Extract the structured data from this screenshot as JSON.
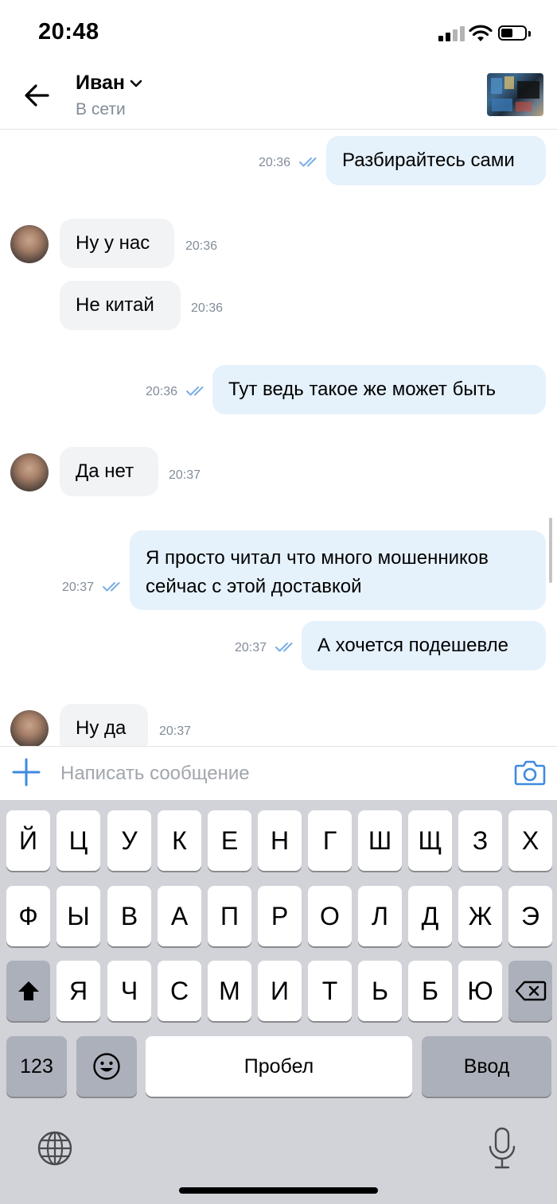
{
  "status_bar": {
    "time": "20:48"
  },
  "header": {
    "contact_name": "Иван",
    "contact_status": "В сети"
  },
  "messages": [
    {
      "direction": "out",
      "text": "Разбирайтесь сами",
      "time": "20:36",
      "read": true
    },
    {
      "direction": "in",
      "text": "Ну у нас",
      "time": "20:36",
      "avatar": true
    },
    {
      "direction": "in",
      "text": "Не китай",
      "time": "20:36"
    },
    {
      "direction": "out",
      "text": "Тут ведь такое же может быть",
      "time": "20:36",
      "read": true
    },
    {
      "direction": "in",
      "text": "Да нет",
      "time": "20:37",
      "avatar": true
    },
    {
      "direction": "out",
      "text": "Я просто читал что много мошенников сейчас с этой доставкой",
      "time": "20:37",
      "read": true
    },
    {
      "direction": "out",
      "text": "А хочется подешевле",
      "time": "20:37",
      "read": true
    },
    {
      "direction": "in",
      "text": "Ну да",
      "time": "20:37",
      "avatar": true
    }
  ],
  "composer": {
    "placeholder": "Написать сообщение"
  },
  "keyboard": {
    "row1": [
      "Й",
      "Ц",
      "У",
      "К",
      "Е",
      "Н",
      "Г",
      "Ш",
      "Щ",
      "З",
      "Х"
    ],
    "row2": [
      "Ф",
      "Ы",
      "В",
      "А",
      "П",
      "Р",
      "О",
      "Л",
      "Д",
      "Ж",
      "Э"
    ],
    "row3": [
      "Я",
      "Ч",
      "С",
      "М",
      "И",
      "Т",
      "Ь",
      "Б",
      "Ю"
    ],
    "numbers_label": "123",
    "space_label": "Пробел",
    "return_label": "Ввод"
  },
  "colors": {
    "outgoing_bubble": "#e5f1fb",
    "incoming_bubble": "#f2f3f5",
    "accent": "#3f8ae0",
    "muted_text": "#818c99",
    "keyboard_bg": "#d1d3d9"
  },
  "icons": [
    "back-arrow-icon",
    "chevron-down-icon",
    "read-check-icon",
    "plus-icon",
    "camera-icon",
    "shift-icon",
    "backspace-icon",
    "emoji-icon",
    "globe-icon",
    "microphone-icon"
  ]
}
